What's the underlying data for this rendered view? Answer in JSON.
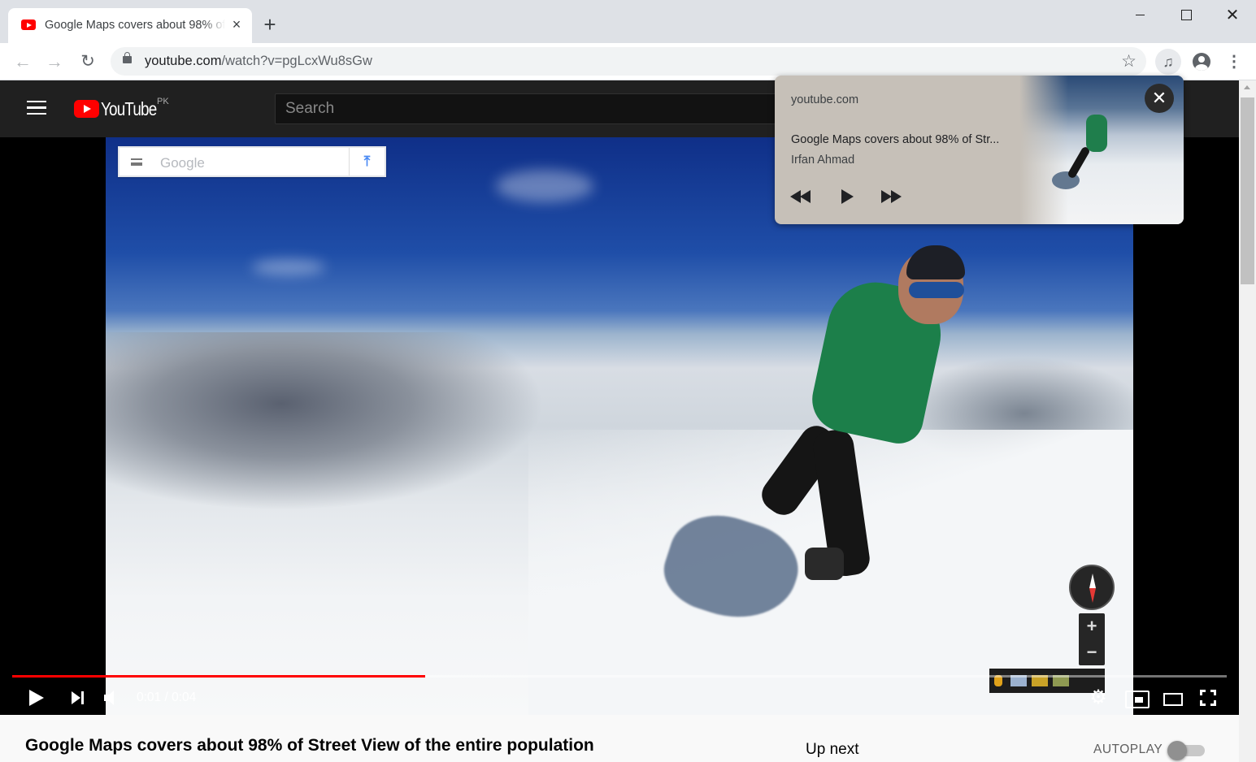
{
  "browser": {
    "tab": {
      "title": "Google Maps covers about 98% of Street View of the entire population",
      "close_icon": "×"
    },
    "new_tab_icon": "+",
    "window": {
      "minimize": "minimize",
      "maximize": "maximize",
      "close_glyph": "✕"
    },
    "nav": {
      "back_glyph": "←",
      "forward_glyph": "→",
      "reload_glyph": "↻"
    },
    "address": {
      "host": "youtube.com",
      "path": "/watch?v=pgLcxWu8sGw"
    },
    "bookmark_glyph": "☆",
    "media_glyph": "♫",
    "menu_glyph": "⋮"
  },
  "youtube": {
    "logo_text": "YouTube",
    "country_code": "PK",
    "search_placeholder": "Search"
  },
  "player": {
    "overlay_search_label": "Google",
    "overlay_directions_glyph": "⤒",
    "zoom_in": "+",
    "zoom_out": "−",
    "current_time": "0:01",
    "duration": "0:04",
    "time_display": "0:01 / 0:04",
    "progress": 0.34,
    "settings_glyph": "⚙"
  },
  "video": {
    "title": "Google Maps covers about 98% of Street View of the entire population"
  },
  "sidebar": {
    "up_next": "Up next",
    "autoplay_label": "AUTOPLAY",
    "autoplay_on": false
  },
  "media_popup": {
    "origin": "youtube.com",
    "title": "Google Maps covers about 98% of Str...",
    "artist": "Irfan Ahmad",
    "close_glyph": "✕"
  },
  "colors": {
    "youtube_red": "#ff0000",
    "masthead": "#202020",
    "popup_bg": "#c6c0b8"
  }
}
